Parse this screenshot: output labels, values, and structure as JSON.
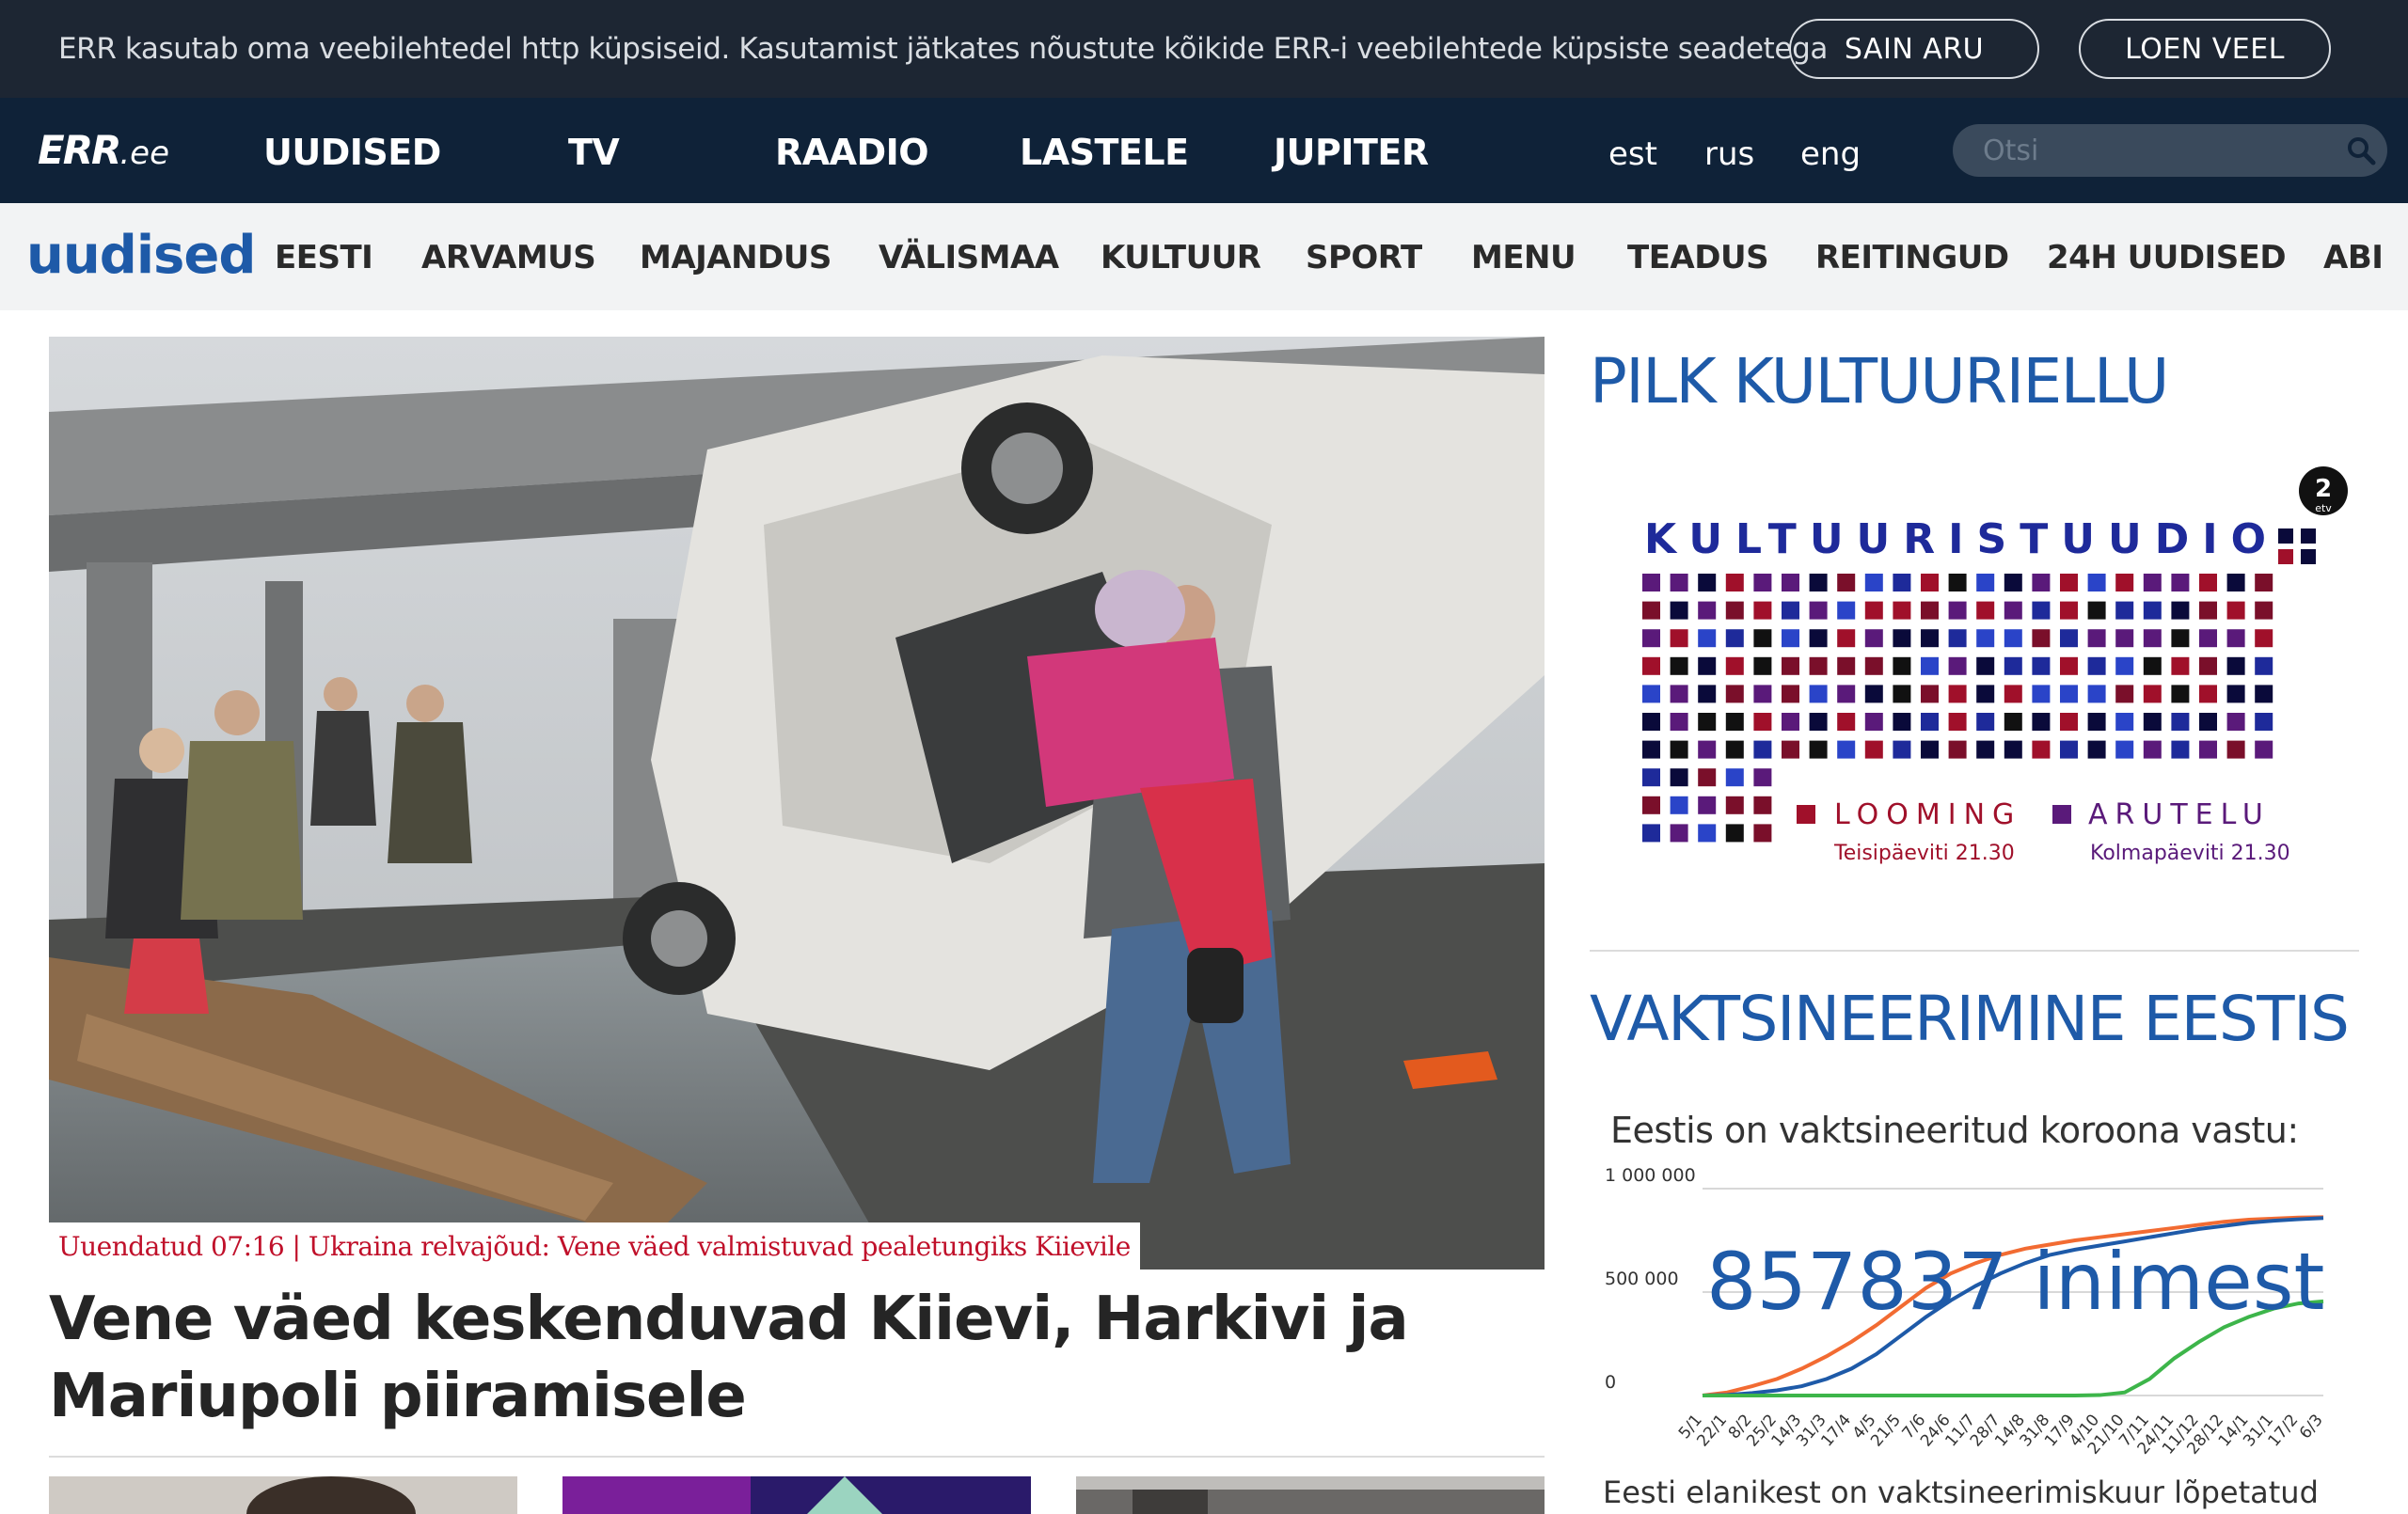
{
  "cookie": {
    "text": "ERR kasutab oma veebilehtedel http küpsiseid. Kasutamist jätkates nõustute kõikide ERR-i veebilehtede küpsiste seadetega",
    "accept_label": "SAIN ARU",
    "more_label": "LOEN VEEL"
  },
  "main_nav": {
    "logo_main": "ERR",
    "logo_suffix": ".ee",
    "items": [
      "UUDISED",
      "TV",
      "RAADIO",
      "LASTELE",
      "JUPITER"
    ],
    "languages": [
      "est",
      "rus",
      "eng"
    ],
    "search_placeholder": "Otsi"
  },
  "section_nav": {
    "title": "uudised",
    "items": [
      "EESTI",
      "ARVAMUS",
      "MAJANDUS",
      "VÄLISMAA",
      "KULTUUR",
      "SPORT",
      "MENU",
      "TEADUS",
      "REITINGUD",
      "24H UUDISED",
      "ABI"
    ]
  },
  "hero": {
    "caption": "Uuendatud 07:16 | Ukraina relvajõud: Vene väed valmistuvad pealetungiks Kiievile",
    "headline": "Vene väed keskenduvad Kiievi, Harkivi ja Mariupoli piiramisele"
  },
  "right": {
    "promo_heading": "PILK KULTUURIELLU",
    "promo": {
      "channel_badge": "2",
      "channel_sub": "etv",
      "title": "KULTUURISTUUDIO",
      "show1": "LOOMING",
      "show1_time": "Teisipäeviti 21.30",
      "show2": "ARUTELU",
      "show2_time": "Kolmapäeviti 21.30"
    },
    "vacc_heading": "VAKTSINEERIMINE EESTIS",
    "vacc_subheading": "Eestis on vaktsineeritud koroona vastu:",
    "vacc_count": "857837 inimest",
    "bottom_note": "Eesti elanikest on vaktsineerimiskuur lõpetatud"
  },
  "chart_data": {
    "type": "line",
    "title": "Eestis on vaktsineeritud koroona vastu:",
    "x": [
      "5/1",
      "22/1",
      "8/2",
      "25/2",
      "14/3",
      "31/3",
      "17/4",
      "4/5",
      "21/5",
      "7/6",
      "24/6",
      "11/7",
      "28/7",
      "14/8",
      "31/8",
      "17/9",
      "4/10",
      "21/10",
      "7/11",
      "24/11",
      "11/12",
      "28/12",
      "14/1",
      "31/1",
      "17/2",
      "6/3"
    ],
    "yticks": [
      "1 000 000",
      "500 000",
      "0"
    ],
    "ylim": [
      0,
      1000000
    ],
    "series": [
      {
        "color": "#f26b32",
        "values": [
          0,
          15000,
          45000,
          80000,
          130000,
          190000,
          260000,
          340000,
          430000,
          520000,
          590000,
          640000,
          680000,
          710000,
          730000,
          750000,
          765000,
          780000,
          795000,
          810000,
          825000,
          840000,
          850000,
          855000,
          860000,
          862000
        ]
      },
      {
        "color": "#1e5aa8",
        "values": [
          0,
          3000,
          12000,
          25000,
          45000,
          80000,
          130000,
          200000,
          290000,
          380000,
          460000,
          530000,
          590000,
          640000,
          680000,
          705000,
          725000,
          745000,
          765000,
          785000,
          805000,
          820000,
          835000,
          845000,
          852000,
          857837
        ]
      },
      {
        "color": "#3db54a",
        "values": [
          0,
          0,
          0,
          0,
          0,
          0,
          0,
          0,
          0,
          0,
          0,
          0,
          0,
          0,
          0,
          0,
          2000,
          15000,
          80000,
          180000,
          260000,
          330000,
          380000,
          420000,
          445000,
          455000
        ]
      }
    ]
  }
}
